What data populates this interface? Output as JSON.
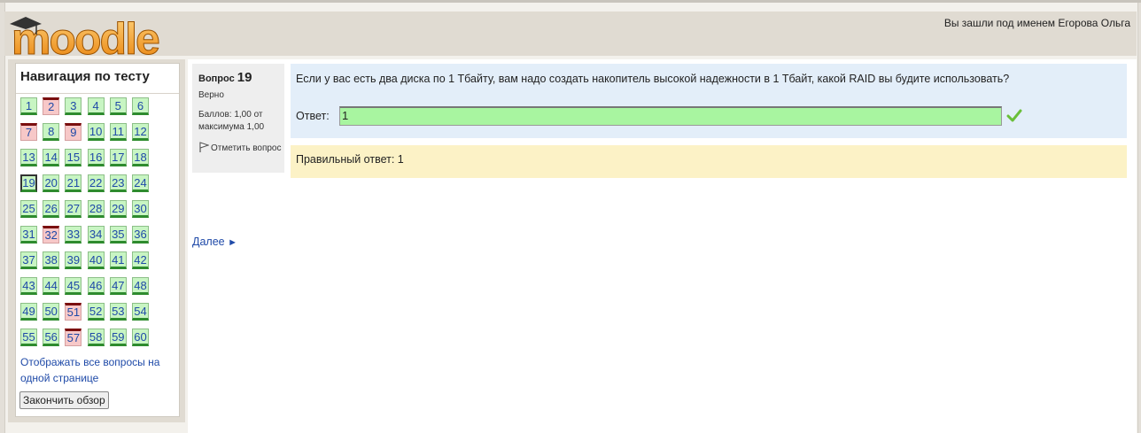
{
  "header": {
    "logo_text": "moodle",
    "login_info": "Вы зашли под именем Егорова Ольга"
  },
  "navigation": {
    "title": "Навигация по тесту",
    "questions": [
      {
        "n": "1",
        "state": "correct"
      },
      {
        "n": "2",
        "state": "wrong"
      },
      {
        "n": "3",
        "state": "correct"
      },
      {
        "n": "4",
        "state": "correct"
      },
      {
        "n": "5",
        "state": "correct"
      },
      {
        "n": "6",
        "state": "correct"
      },
      {
        "n": "7",
        "state": "wrong"
      },
      {
        "n": "8",
        "state": "correct"
      },
      {
        "n": "9",
        "state": "wrong"
      },
      {
        "n": "10",
        "state": "correct"
      },
      {
        "n": "11",
        "state": "correct"
      },
      {
        "n": "12",
        "state": "correct"
      },
      {
        "n": "13",
        "state": "correct"
      },
      {
        "n": "14",
        "state": "correct"
      },
      {
        "n": "15",
        "state": "correct"
      },
      {
        "n": "16",
        "state": "correct"
      },
      {
        "n": "17",
        "state": "correct"
      },
      {
        "n": "18",
        "state": "correct"
      },
      {
        "n": "19",
        "state": "current"
      },
      {
        "n": "20",
        "state": "correct"
      },
      {
        "n": "21",
        "state": "correct"
      },
      {
        "n": "22",
        "state": "correct"
      },
      {
        "n": "23",
        "state": "correct"
      },
      {
        "n": "24",
        "state": "correct"
      },
      {
        "n": "25",
        "state": "correct"
      },
      {
        "n": "26",
        "state": "correct"
      },
      {
        "n": "27",
        "state": "correct"
      },
      {
        "n": "28",
        "state": "correct"
      },
      {
        "n": "29",
        "state": "correct"
      },
      {
        "n": "30",
        "state": "correct"
      },
      {
        "n": "31",
        "state": "correct"
      },
      {
        "n": "32",
        "state": "wrong"
      },
      {
        "n": "33",
        "state": "correct"
      },
      {
        "n": "34",
        "state": "correct"
      },
      {
        "n": "35",
        "state": "correct"
      },
      {
        "n": "36",
        "state": "correct"
      },
      {
        "n": "37",
        "state": "correct"
      },
      {
        "n": "38",
        "state": "correct"
      },
      {
        "n": "39",
        "state": "correct"
      },
      {
        "n": "40",
        "state": "correct"
      },
      {
        "n": "41",
        "state": "correct"
      },
      {
        "n": "42",
        "state": "correct"
      },
      {
        "n": "43",
        "state": "correct"
      },
      {
        "n": "44",
        "state": "correct"
      },
      {
        "n": "45",
        "state": "correct"
      },
      {
        "n": "46",
        "state": "correct"
      },
      {
        "n": "47",
        "state": "correct"
      },
      {
        "n": "48",
        "state": "correct"
      },
      {
        "n": "49",
        "state": "correct"
      },
      {
        "n": "50",
        "state": "correct"
      },
      {
        "n": "51",
        "state": "wrong"
      },
      {
        "n": "52",
        "state": "correct"
      },
      {
        "n": "53",
        "state": "correct"
      },
      {
        "n": "54",
        "state": "correct"
      },
      {
        "n": "55",
        "state": "correct"
      },
      {
        "n": "56",
        "state": "correct"
      },
      {
        "n": "57",
        "state": "wrong"
      },
      {
        "n": "58",
        "state": "correct"
      },
      {
        "n": "59",
        "state": "correct"
      },
      {
        "n": "60",
        "state": "correct"
      }
    ],
    "show_all": "Отображать все вопросы на одной странице",
    "finish_button": "Закончить обзор"
  },
  "question_info": {
    "label": "Вопрос",
    "number": "19",
    "state": "Верно",
    "grade": "Баллов: 1,00 от максимума 1,00",
    "flag_label": "Отметить вопрос"
  },
  "question": {
    "text": "Если у вас есть два диска по 1 Тбайту, вам надо создать накопитель высокой надежности в 1 Тбайт, какой RAID вы будите использовать?",
    "answer_label": "Ответ:",
    "answer_value": "1"
  },
  "feedback": {
    "right_answer": "Правильный ответ: 1"
  },
  "next_link": "Далее",
  "colors": {
    "correct_bg": "#c8f5c3",
    "wrong_bg": "#f7c8c8",
    "question_bg": "#e3eef9",
    "feedback_bg": "#fcf2c6",
    "link": "#1f4aa8"
  }
}
